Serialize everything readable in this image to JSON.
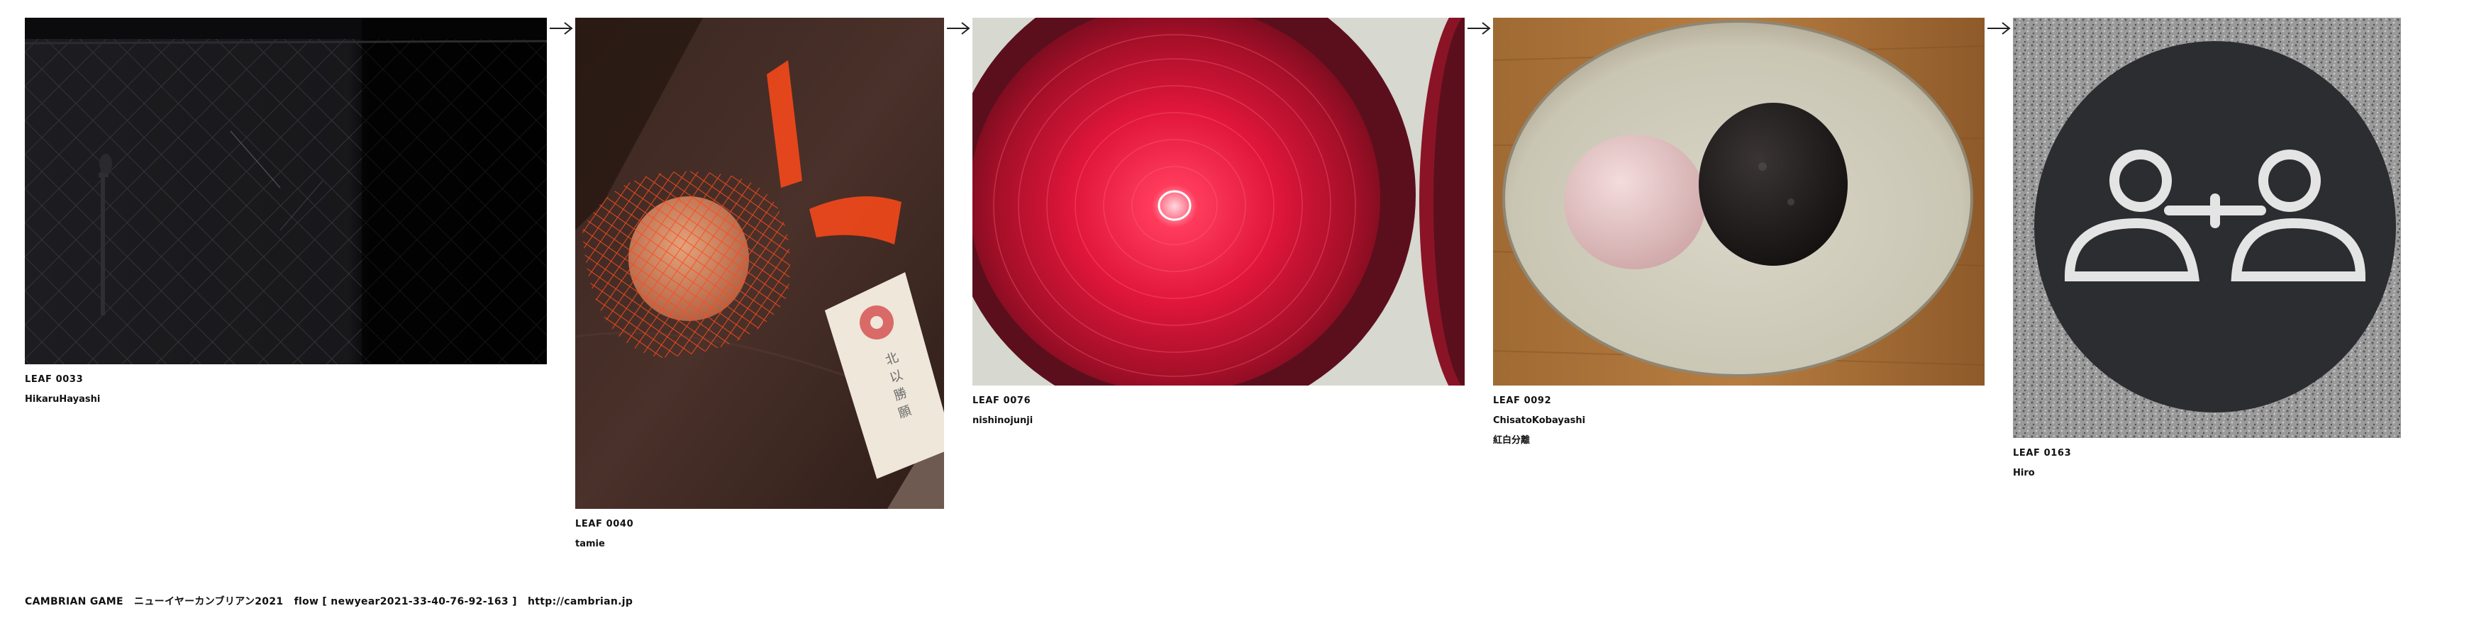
{
  "leaves": [
    {
      "id": "LEAF 0033",
      "author": "HikaruHayashi",
      "image": "night chain-link fence with pipe and light streak"
    },
    {
      "id": "LEAF 0040",
      "author": "tamie",
      "image": "red mesh bag with ball and paper tag on wooden surface"
    },
    {
      "id": "LEAF 0076",
      "author": "nishinojunji",
      "image": "glowing red dome lamp lens"
    },
    {
      "id": "LEAF 0092",
      "author": "ChisatoKobayashi",
      "title": "紅白分離",
      "image": "ceramic bowl with pink and dark sweets"
    },
    {
      "id": "LEAF 0163",
      "author": "Hiro",
      "image": "floor sign with two figures connected"
    }
  ],
  "arrow_icon": "right-arrow-icon",
  "footer": {
    "game": "CAMBRIAN GAME",
    "event": "ニューイヤーカンブリアン2021",
    "flow": "flow [ newyear2021-33-40-76-92-163 ]",
    "url": "http://cambrian.jp"
  },
  "colors": {
    "background": "#ffffff",
    "text": "#111111"
  }
}
